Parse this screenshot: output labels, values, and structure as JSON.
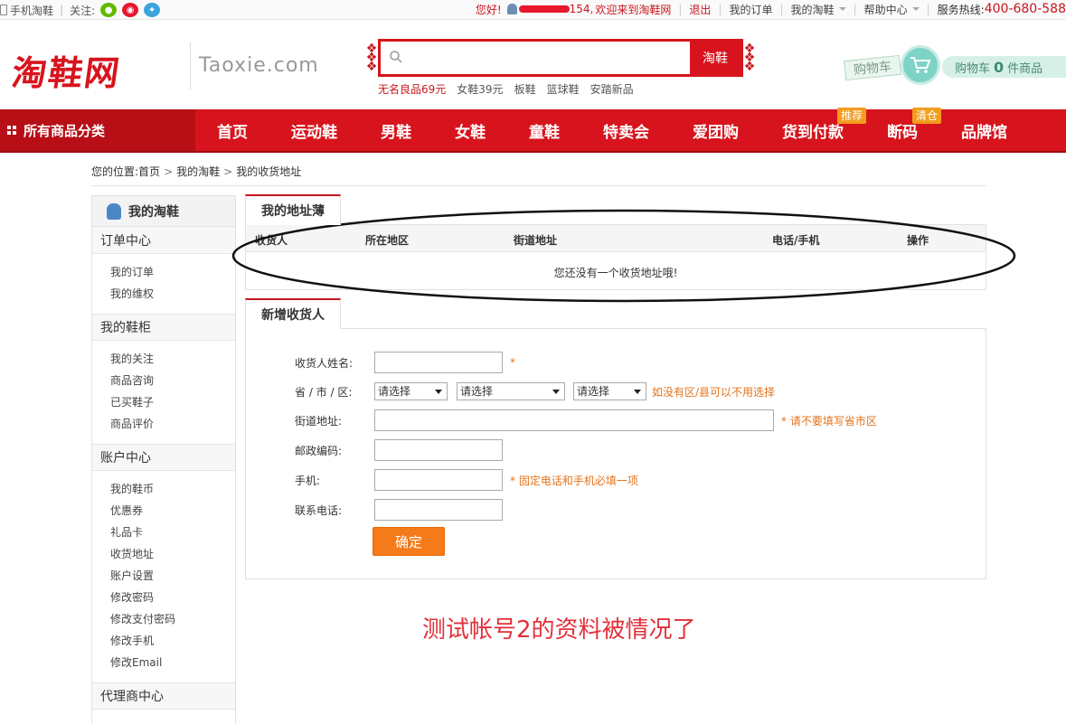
{
  "topbar": {
    "mobile": "手机淘鞋",
    "follow": "关注:",
    "greeting": "您好!",
    "user_suffix": "154,",
    "welcome": "欢迎来到淘鞋网",
    "logout": "退出",
    "my_orders": "我的订单",
    "my_taoxie": "我的淘鞋",
    "help": "帮助中心",
    "hotline_label": "服务热线:",
    "hotline": "400-680-588"
  },
  "header": {
    "logo": "淘鞋网",
    "domain": "Taoxie.com",
    "search_placeholder": "",
    "search_button": "淘鞋",
    "hotwords": [
      {
        "text": "无名良品69元",
        "red": true
      },
      {
        "text": "女鞋39元",
        "red": false
      },
      {
        "text": "板鞋",
        "red": false
      },
      {
        "text": "篮球鞋",
        "red": false
      },
      {
        "text": "安踏新品",
        "red": false
      }
    ],
    "cart_tag": "购物车",
    "cart_label": "购物车",
    "cart_count": "0",
    "cart_unit": "件商品"
  },
  "nav": {
    "all_categories": "所有商品分类",
    "items": [
      "首页",
      "运动鞋",
      "男鞋",
      "女鞋",
      "童鞋",
      "特卖会",
      "爱团购",
      "货到付款",
      "断码",
      "品牌馆"
    ],
    "badge_recommend": "推荐",
    "badge_clear": "清仓"
  },
  "breadcrumb": {
    "prefix": "您的位置:",
    "home": "首页",
    "my_taoxie": "我的淘鞋",
    "current": "我的收货地址"
  },
  "sidebar": {
    "title": "我的淘鞋",
    "sections": [
      {
        "title": "订单中心",
        "items": [
          "我的订单",
          "我的维权"
        ]
      },
      {
        "title": "我的鞋柜",
        "items": [
          "我的关注",
          "商品咨询",
          "已买鞋子",
          "商品评价"
        ]
      },
      {
        "title": "账户中心",
        "items": [
          "我的鞋币",
          "优惠券",
          "礼品卡",
          "收货地址",
          "账户设置",
          "修改密码",
          "修改支付密码",
          "修改手机",
          "修改Email"
        ]
      },
      {
        "title": "代理商中心",
        "items": []
      }
    ]
  },
  "address_book": {
    "tab": "我的地址薄",
    "columns": [
      "收货人",
      "所在地区",
      "街道地址",
      "电话/手机",
      "操作"
    ],
    "empty": "您还没有一个收货地址哦!"
  },
  "new_address": {
    "tab": "新增收货人",
    "name_label": "收货人姓名:",
    "region_label": "省 / 市 / 区:",
    "street_label": "街道地址:",
    "zip_label": "邮政编码:",
    "mobile_label": "手机:",
    "phone_label": "联系电话:",
    "select_default": "请选择",
    "asterisk": "*",
    "region_hint": "如没有区/县可以不用选择",
    "street_hint": "* 请不要填写省市区",
    "mobile_hint": "* 固定电话和手机必填一项",
    "confirm": "确定"
  },
  "annotation": "测试帐号2的资料被情况了",
  "colors": {
    "brand_red": "#d7141d",
    "orange_hint": "#e4731b",
    "button_orange": "#f57a19"
  }
}
